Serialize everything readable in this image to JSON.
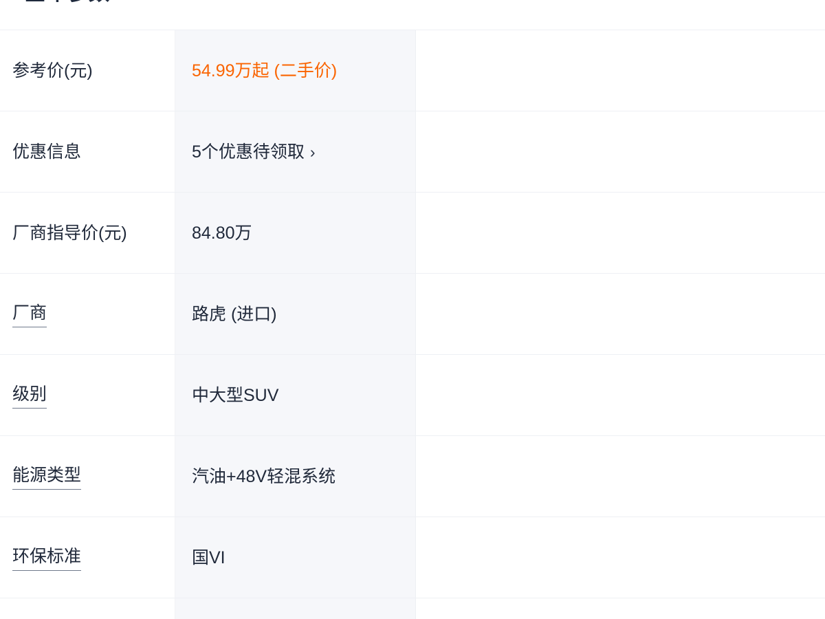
{
  "section": {
    "heading": "全车参数"
  },
  "accent_colors": {
    "price_orange": "#fa6400",
    "text_dark": "#20293a",
    "value_cell_bg": "#f6f7fa",
    "divider": "#eef0f4"
  },
  "icons": {
    "chevron_right": "›"
  },
  "spec_table": {
    "rows": [
      {
        "label": "参考价(元)",
        "label_has_tip_underline": false,
        "value": "54.99万起 (二手价)",
        "value_style": "price",
        "has_chevron": false
      },
      {
        "label": "优惠信息",
        "label_has_tip_underline": false,
        "value": "5个优惠待领取",
        "value_style": "normal",
        "has_chevron": true
      },
      {
        "label": "厂商指导价(元)",
        "label_has_tip_underline": false,
        "value": "84.80万",
        "value_style": "normal",
        "has_chevron": false
      },
      {
        "label": "厂商",
        "label_has_tip_underline": true,
        "value": "路虎 (进口)",
        "value_style": "normal",
        "has_chevron": false
      },
      {
        "label": "级别",
        "label_has_tip_underline": true,
        "value": "中大型SUV",
        "value_style": "normal",
        "has_chevron": false
      },
      {
        "label": "能源类型",
        "label_has_tip_underline": true,
        "value": "汽油+48V轻混系统",
        "value_style": "normal",
        "has_chevron": false
      },
      {
        "label": "环保标准",
        "label_has_tip_underline": true,
        "value": "国VI",
        "value_style": "normal",
        "has_chevron": false
      },
      {
        "label": "",
        "label_has_tip_underline": false,
        "value": "",
        "value_style": "normal",
        "has_chevron": false
      }
    ]
  }
}
